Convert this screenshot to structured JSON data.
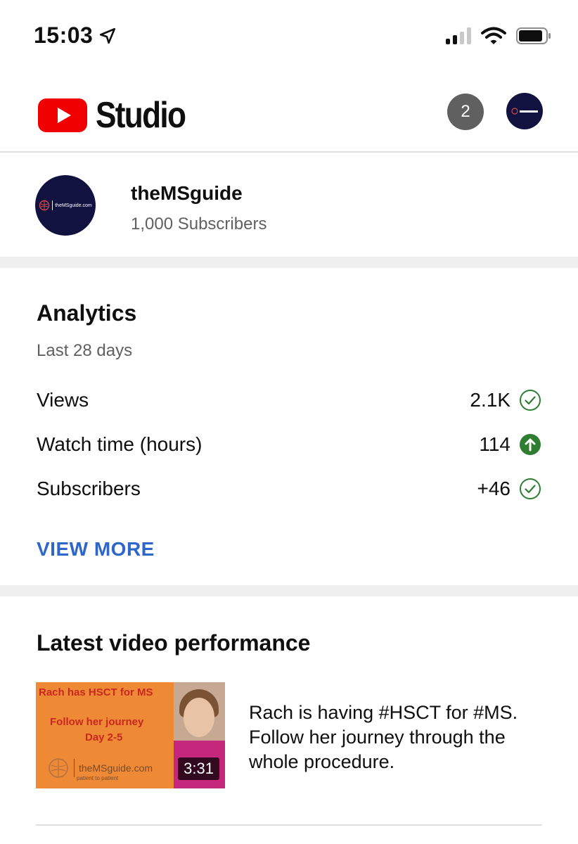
{
  "status_bar": {
    "time": "15:03",
    "icons": [
      "location-arrow-icon",
      "cellular-signal-icon",
      "wifi-icon",
      "battery-icon"
    ]
  },
  "header": {
    "logo_text": "Studio",
    "notification_count": "2"
  },
  "channel": {
    "name": "theMSguide",
    "subscribers": "1,000 Subscribers",
    "avatar_logo_text": "theMSguide.com"
  },
  "analytics": {
    "title": "Analytics",
    "period": "Last 28 days",
    "metrics": [
      {
        "label": "Views",
        "value": "2.1K",
        "icon": "check-circle-icon"
      },
      {
        "label": "Watch time (hours)",
        "value": "114",
        "icon": "arrow-up-circle-icon"
      },
      {
        "label": "Subscribers",
        "value": "+46",
        "icon": "check-circle-icon"
      }
    ],
    "view_more": "VIEW MORE"
  },
  "latest_video": {
    "title": "Latest video performance",
    "thumbnail": {
      "line1": "Rach has HSCT for MS",
      "line2": "Follow her journey",
      "line3": "Day 2-5",
      "brand": "theMSguide.com",
      "brand_sub": "patient to patient"
    },
    "duration": "3:31",
    "video_title": "Rach is having #HSCT for #MS. Follow her journey through the whole procedure."
  },
  "colors": {
    "youtube_red": "#f00000",
    "link_blue": "#2f66c9",
    "success_green": "#2e7d32",
    "channel_navy": "#121241",
    "thumbnail_orange": "#ee8a36"
  }
}
